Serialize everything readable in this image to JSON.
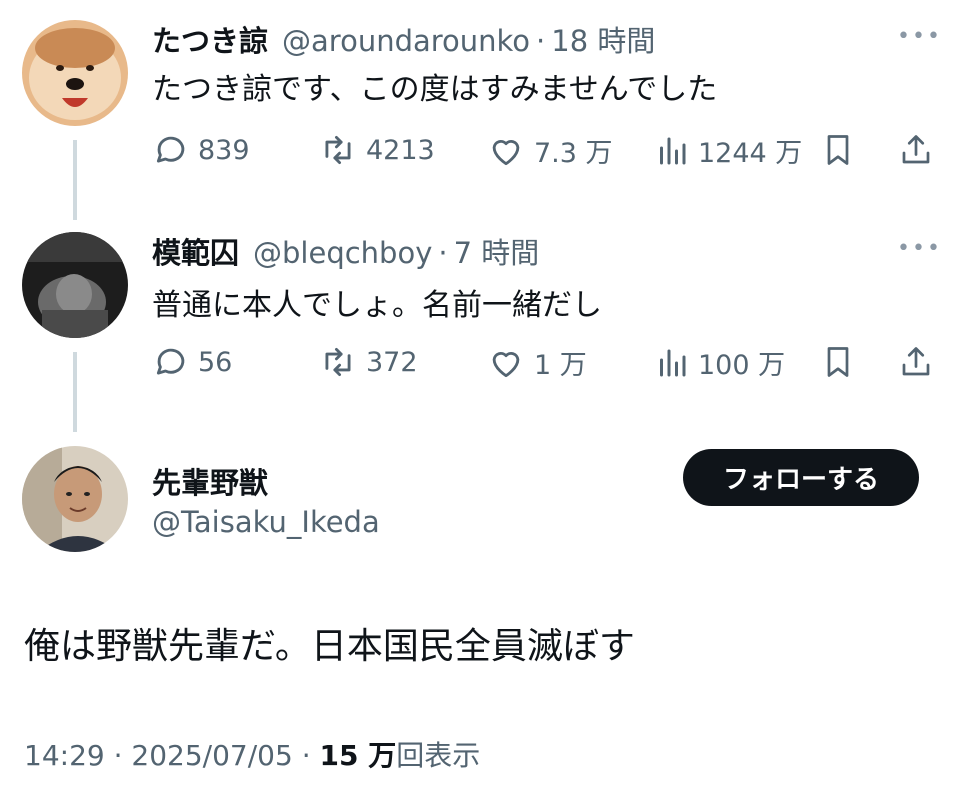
{
  "tweets": [
    {
      "display_name": "たつき諒",
      "handle": "@aroundarounko",
      "dot": "·",
      "time": "18 時間",
      "more": "•••",
      "text": "たつき諒です、この度はすみませんでした",
      "replies": "839",
      "retweets": "4213",
      "likes": "7.3 万",
      "views": "1244 万"
    },
    {
      "display_name": "模範囚",
      "handle": "@bleqchboy",
      "dot": "·",
      "time": "7 時間",
      "more": "•••",
      "text": "普通に本人でしょ。名前一緒だし",
      "replies": "56",
      "retweets": "372",
      "likes": "1 万",
      "views": "100 万"
    }
  ],
  "main": {
    "display_name": "先輩野獣",
    "handle": "@Taisaku_Ikeda",
    "follow_label": "フォローする",
    "text": "俺は野獣先輩だ。日本国民全員滅ぼす",
    "time": "14:29",
    "dot1": "·",
    "date": "2025/07/05",
    "dot2": "·",
    "views_count": "15 万",
    "views_label": "回表示"
  },
  "icons": [
    "reply-icon",
    "retweet-icon",
    "like-icon",
    "views-icon",
    "bookmark-icon",
    "share-icon",
    "more-icon"
  ],
  "colors": {
    "text": "#0f1419",
    "secondary": "#536471",
    "thread_line": "#cfd9de",
    "follow_bg": "#0f1419"
  }
}
